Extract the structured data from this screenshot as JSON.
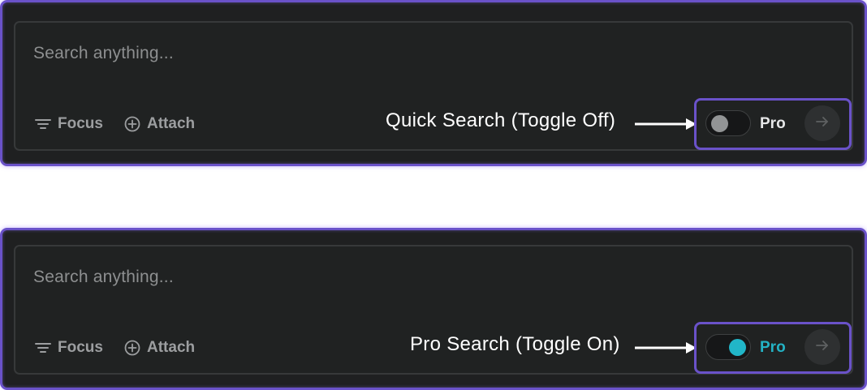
{
  "colors": {
    "panel_bg": "#1f2021",
    "accent_border": "#6a52c9",
    "toggle_on": "#21b6c8",
    "toggle_off": "#929495"
  },
  "panels": [
    {
      "placeholder": "Search anything...",
      "focus_label": "Focus",
      "attach_label": "Attach",
      "callout": "Quick Search (Toggle Off)",
      "toggle_state": "off",
      "pro_label": "Pro",
      "icons": [
        "filter-lines-icon",
        "plus-circle-icon",
        "arrow-right-icon"
      ]
    },
    {
      "placeholder": "Search anything...",
      "focus_label": "Focus",
      "attach_label": "Attach",
      "callout": "Pro Search (Toggle On)",
      "toggle_state": "on",
      "pro_label": "Pro",
      "icons": [
        "filter-lines-icon",
        "plus-circle-icon",
        "arrow-right-icon"
      ]
    }
  ]
}
